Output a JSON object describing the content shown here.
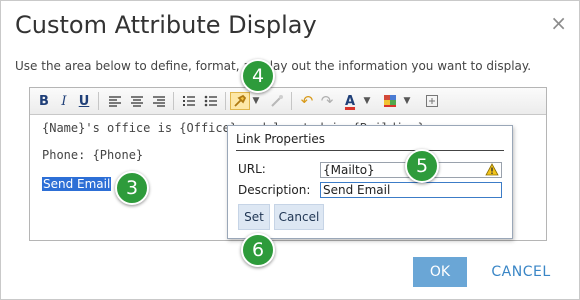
{
  "dialog": {
    "title": "Custom Attribute Display",
    "close_label": "×",
    "description": "Use the area below to define, format, and lay out the information you want to display."
  },
  "toolbar": {
    "bold": "B",
    "italic": "I",
    "underline": "U",
    "font_color": "A"
  },
  "editor": {
    "line1": "{Name}'s office is {Office} and located in {Building}.",
    "line2": "Phone: {Phone}",
    "selected_link": "Send Email"
  },
  "link_popup": {
    "title": "Link Properties",
    "url_label": "URL:",
    "url_value": "{Mailto}",
    "description_label": "Description:",
    "description_value": "Send Email",
    "set_label": "Set",
    "cancel_label": "Cancel"
  },
  "badges": {
    "b3": "3",
    "b4": "4",
    "b5": "5",
    "b6": "6"
  },
  "footer": {
    "ok_label": "OK",
    "cancel_label": "CANCEL"
  },
  "colors": {
    "accent": "#2d6fd6",
    "badge": "#2e9b3b",
    "ok_button": "#6aa6d6",
    "cancel_text": "#3a86c6"
  }
}
